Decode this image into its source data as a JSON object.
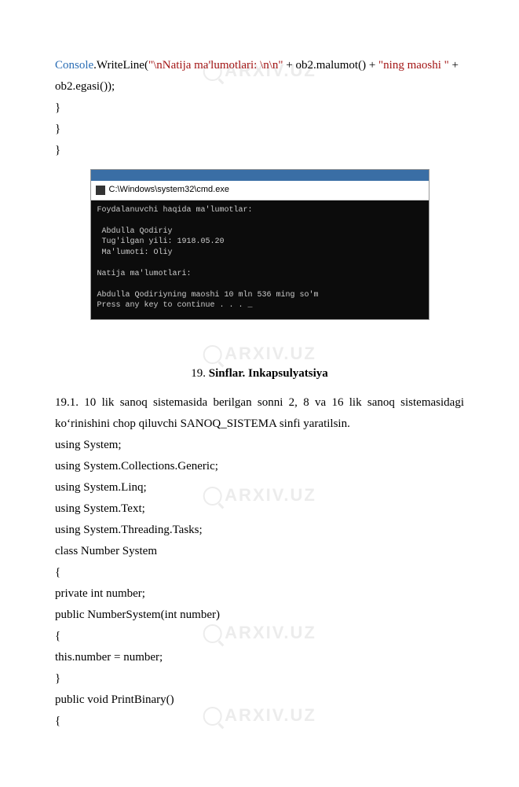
{
  "watermark": "ARXIV.UZ",
  "code_top": {
    "console": "Console",
    "write": ".WriteLine(",
    "str1": "\"\\nNatija ma'lumotlari: \\n\\n\"",
    "mid": " + ob2.malumot() + ",
    "str2": "\"ning maoshi \"",
    "end": " + ",
    "line2": "ob2.egasi());",
    "close1": "    }",
    "close2": "  }",
    "close3": "}"
  },
  "console": {
    "title": "C:\\Windows\\system32\\cmd.exe",
    "body": "Foydalanuvchi haqida ma'lumotlar:\n\n Abdulla Qodiriy\n Tug'ilgan yili: 1918.05.20\n Ma'lumoti: Oliy\n\nNatija ma'lumotlari:\n\nAbdulla Qodiriyning maoshi 10 mln 536 ming so'm\nPress any key to continue . . . _"
  },
  "heading": {
    "num": "19. ",
    "title": "Sinflar. Inkapsulyatsiya"
  },
  "task": "19.1. 10 lik sanoq sistemasida berilgan sonni 2, 8 va 16 lik sanoq sistemasidagi koʻrinishini chop qiluvchi SANOQ_SISTEMA sinfi yaratilsin.",
  "src": [
    "using System;",
    "using System.Collections.Generic;",
    "using System.Linq;",
    "using System.Text;",
    "using System.Threading.Tasks;",
    "class Number System",
    "{",
    "  private int number;",
    "  public NumberSystem(int number)",
    "  {",
    "this.number = number;",
    "  }",
    "  public void PrintBinary()",
    "  {"
  ]
}
